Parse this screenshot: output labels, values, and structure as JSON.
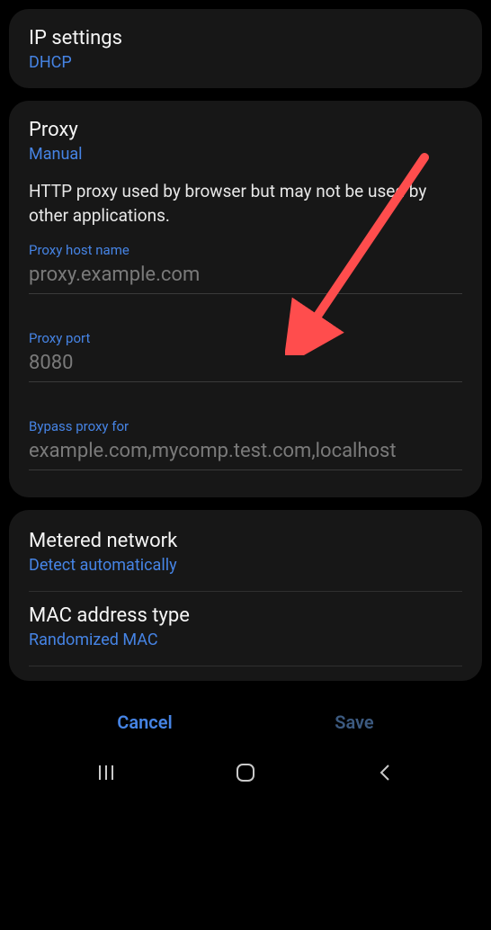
{
  "ip_settings": {
    "title": "IP settings",
    "value": "DHCP"
  },
  "proxy": {
    "title": "Proxy",
    "value": "Manual",
    "description": "HTTP proxy used by browser but may not be used by other applications.",
    "host": {
      "label": "Proxy host name",
      "value": "",
      "placeholder": "proxy.example.com"
    },
    "port": {
      "label": "Proxy port",
      "value": "",
      "placeholder": "8080"
    },
    "bypass": {
      "label": "Bypass proxy for",
      "value": "",
      "placeholder": "example.com,mycomp.test.com,localhost"
    }
  },
  "metered": {
    "title": "Metered network",
    "value": "Detect automatically"
  },
  "mac": {
    "title": "MAC address type",
    "value": "Randomized MAC"
  },
  "buttons": {
    "cancel": "Cancel",
    "save": "Save"
  },
  "annotation": {
    "arrow_color": "#ff4d4d"
  }
}
